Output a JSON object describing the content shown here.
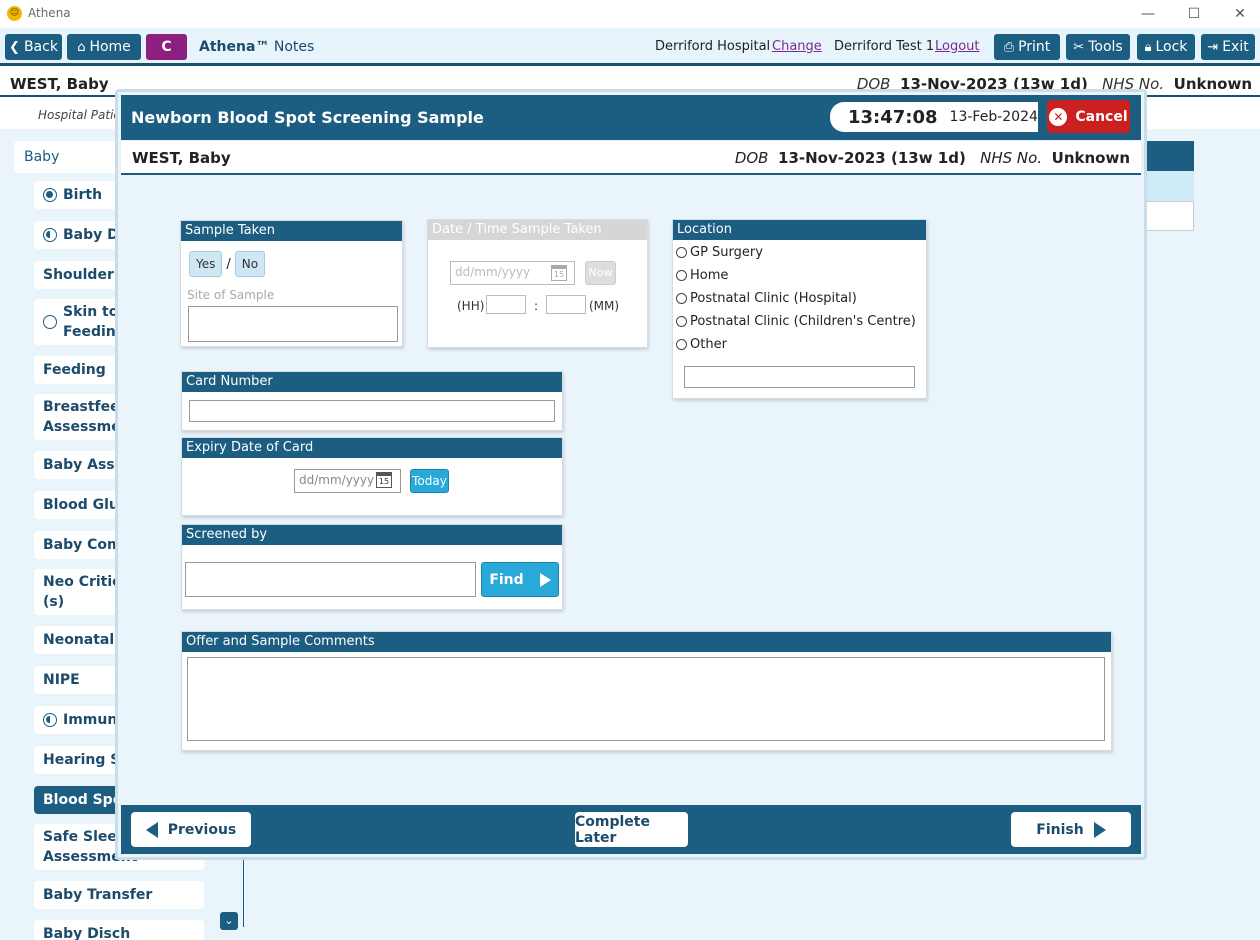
{
  "window": {
    "app_name": "Athena",
    "logo_glyph": "☺",
    "minimize": "—",
    "maximize": "☐",
    "close": "✕"
  },
  "toolbar": {
    "back": "Back",
    "home": "Home",
    "c_badge": "C",
    "brand": "Athena™",
    "notes": "Notes",
    "hospital": "Derriford Hospital",
    "change": "Change",
    "user": "Derriford Test 1",
    "logout": "Logout",
    "print": "Print",
    "tools": "Tools",
    "lock": "Lock",
    "exit": "Exit"
  },
  "patient": {
    "name": "WEST, Baby",
    "dob_label": "DOB",
    "dob": "13-Nov-2023 (13w 1d)",
    "nhs_label": "NHS No.",
    "nhs": "Unknown"
  },
  "subbar": {
    "text": "Hospital Patie"
  },
  "sidebar": {
    "header": "Baby",
    "items": [
      {
        "label": "Birth",
        "radio": "full"
      },
      {
        "label": "Baby De",
        "radio": "half"
      },
      {
        "label": "Shoulder D",
        "radio": ""
      },
      {
        "label": "Skin to S\nFeeding",
        "radio": "empty"
      },
      {
        "label": "Feeding",
        "radio": ""
      },
      {
        "label": "Breastfeedi\nAssessmen",
        "radio": ""
      },
      {
        "label": "Baby Asses",
        "radio": ""
      },
      {
        "label": "Blood Gluc",
        "radio": ""
      },
      {
        "label": "Baby Comm",
        "radio": ""
      },
      {
        "label": "Neo Critica\n(s)",
        "radio": ""
      },
      {
        "label": "Neonatal",
        "radio": ""
      },
      {
        "label": "NIPE",
        "radio": ""
      },
      {
        "label": "Immunis",
        "radio": "half"
      },
      {
        "label": "Hearing Sc",
        "radio": ""
      },
      {
        "label": "Blood Spot",
        "radio": "",
        "selected": true
      },
      {
        "label": "Safe Sleepi\nAssessment",
        "radio": ""
      },
      {
        "label": "Baby Transfer",
        "radio": ""
      },
      {
        "label": "Baby Disch",
        "radio": ""
      }
    ]
  },
  "modal": {
    "title": "Newborn Blood Spot Screening Sample",
    "time": "13:47:08",
    "date": "13-Feb-2024",
    "cancel": "Cancel"
  },
  "sample_taken": {
    "title": "Sample Taken",
    "yes": "Yes",
    "sep": "/",
    "no": "No",
    "site_label": "Site of Sample",
    "site_value": ""
  },
  "date_time": {
    "title": "Date / Time Sample Taken",
    "date_placeholder": "dd/mm/yyyy",
    "now": "Now",
    "hh": "(HH)",
    "colon": ":",
    "mm": "(MM)",
    "cal_day": "15"
  },
  "location": {
    "title": "Location",
    "options": [
      "GP Surgery",
      "Home",
      "Postnatal Clinic (Hospital)",
      "Postnatal Clinic (Children's Centre)",
      "Other"
    ],
    "other_value": ""
  },
  "card_number": {
    "title": "Card Number",
    "value": ""
  },
  "expiry": {
    "title": "Expiry Date of Card",
    "placeholder": "dd/mm/yyyy",
    "today": "Today",
    "cal_day": "15"
  },
  "screened_by": {
    "title": "Screened by",
    "value": "",
    "find": "Find"
  },
  "comments": {
    "title": "Offer and Sample Comments",
    "value": ""
  },
  "footer": {
    "previous": "Previous",
    "complete_later": "Complete Later",
    "finish": "Finish"
  }
}
